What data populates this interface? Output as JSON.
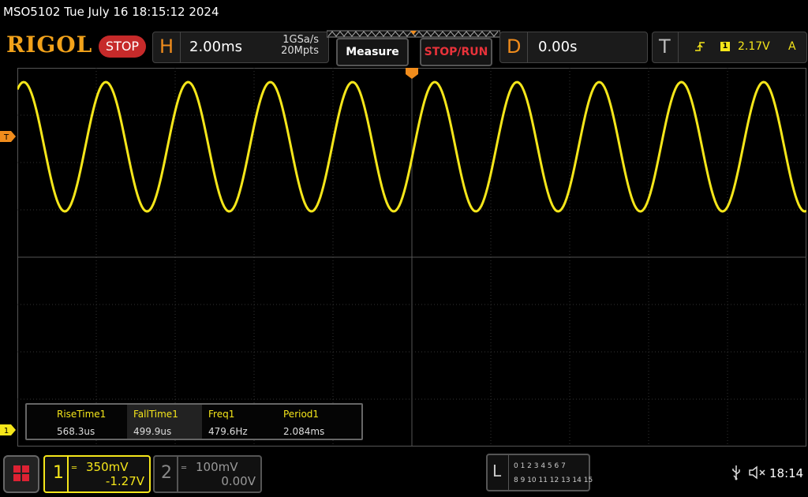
{
  "status_bar": {
    "title": "MSO5102  Tue July 16 18:15:12 2024"
  },
  "header": {
    "logo": "RIGOL",
    "run_state": "STOP",
    "horizontal": {
      "letter": "H",
      "timebase": "2.00ms",
      "sample_rate": "1GSa/s",
      "memory_depth": "20Mpts"
    },
    "measure_label": "Measure",
    "stop_run_label": "STOP/RUN",
    "delay": {
      "letter": "D",
      "value": "0.00s"
    },
    "trigger": {
      "letter": "T",
      "source_label": "1",
      "level": "2.17V",
      "mode": "A"
    }
  },
  "screen": {
    "trigger_marker": "T",
    "channel1_marker": "1",
    "grid_divisions": {
      "x": 10,
      "y": 8
    }
  },
  "measurements": [
    {
      "name": "RiseTime1",
      "value": "568.3us"
    },
    {
      "name": "FallTime1",
      "value": "499.9us"
    },
    {
      "name": "Freq1",
      "value": "479.6Hz"
    },
    {
      "name": "Period1",
      "value": "2.084ms"
    }
  ],
  "channels": {
    "ch1": {
      "number": "1",
      "scale": "350mV",
      "offset": "-1.27V",
      "color": "#f5e61a"
    },
    "ch2": {
      "number": "2",
      "scale": "100mV",
      "offset": "0.00V"
    }
  },
  "logic": {
    "letter": "L",
    "row1": "0 1 2 3   4 5 6 7",
    "row2": "8  9 10 11  12 13 14 15"
  },
  "system": {
    "clock": "18:14",
    "usb_icon": "usb-icon",
    "speaker_icon": "speaker-muted-icon"
  },
  "colors": {
    "accent": "#f08c1c",
    "waveform": "#f5e61a",
    "stop": "#c62a2a"
  }
}
